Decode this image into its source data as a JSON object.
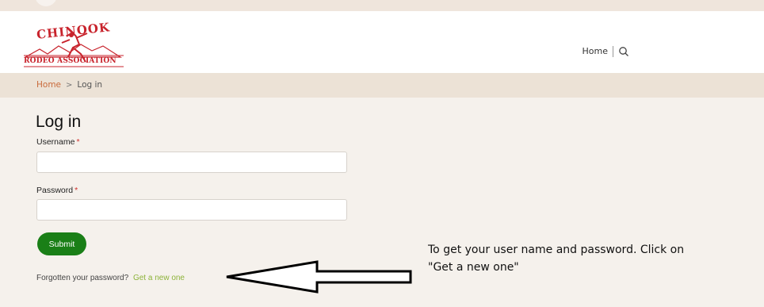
{
  "logo": {
    "top_text": "CHINOOK",
    "bottom_text": "RODEO ASSOCIATION",
    "brand_color": "#c8232c"
  },
  "nav": {
    "home_label": "Home",
    "search_icon": "search-icon"
  },
  "breadcrumb": {
    "home": "Home",
    "separator": ">",
    "current": "Log in"
  },
  "page": {
    "title": "Log in"
  },
  "form": {
    "username_label": "Username",
    "username_value": "",
    "password_label": "Password",
    "password_value": "",
    "required_marker": "*",
    "submit_label": "Submit",
    "submit_color": "#1a7f17",
    "forgot_text": "Forgotten your password?",
    "forgot_link": "Get a new one",
    "link_color": "#8db33a"
  },
  "annotation": {
    "note_line1": "To get your user name and password. Click on",
    "note_line2": "\"Get a new one\"",
    "arrow_icon": "left-arrow-icon"
  }
}
